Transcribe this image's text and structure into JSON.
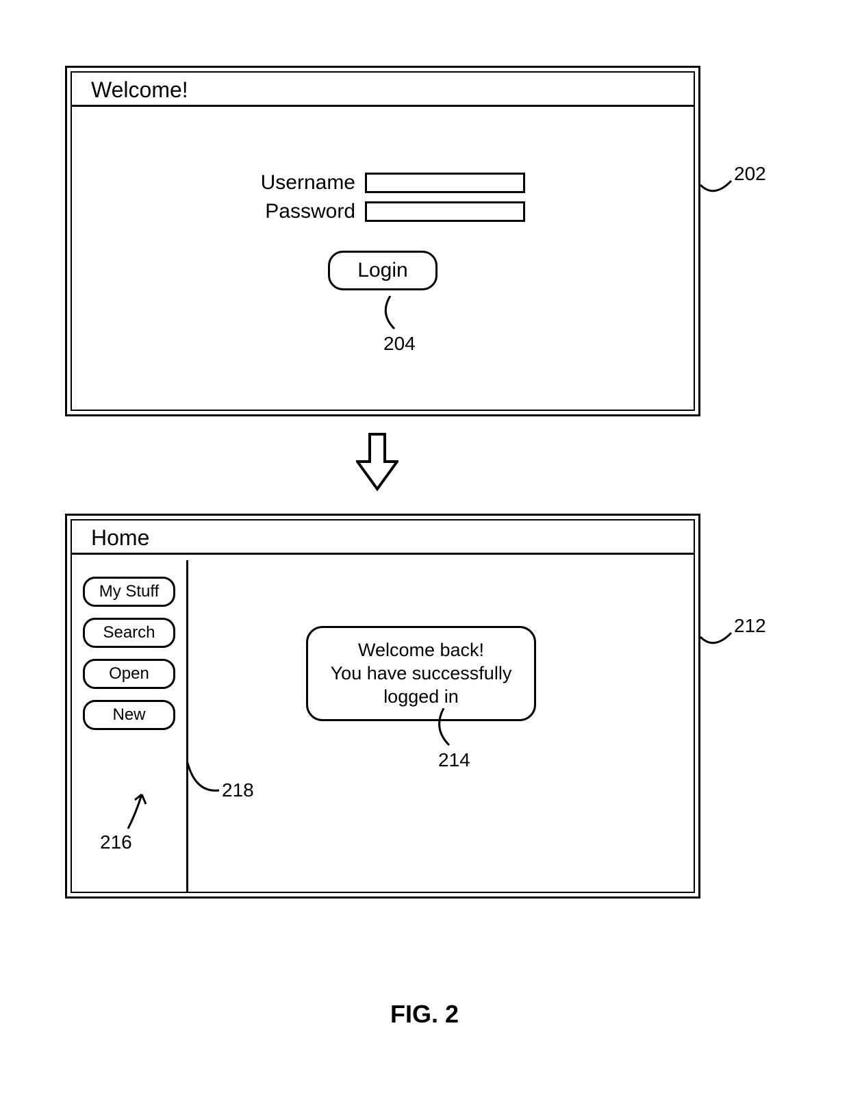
{
  "figure_label": "FIG. 2",
  "top_window": {
    "title": "Welcome!",
    "username_label": "Username",
    "password_label": "Password",
    "login_button": "Login"
  },
  "bottom_window": {
    "title": "Home",
    "sidebar": {
      "my_stuff": "My Stuff",
      "search": "Search",
      "open": "Open",
      "new": "New"
    },
    "message_line1": "Welcome back!",
    "message_line2": "You have successfully",
    "message_line3": "logged in"
  },
  "callouts": {
    "c202": "202",
    "c204": "204",
    "c212": "212",
    "c214": "214",
    "c216": "216",
    "c218": "218"
  }
}
